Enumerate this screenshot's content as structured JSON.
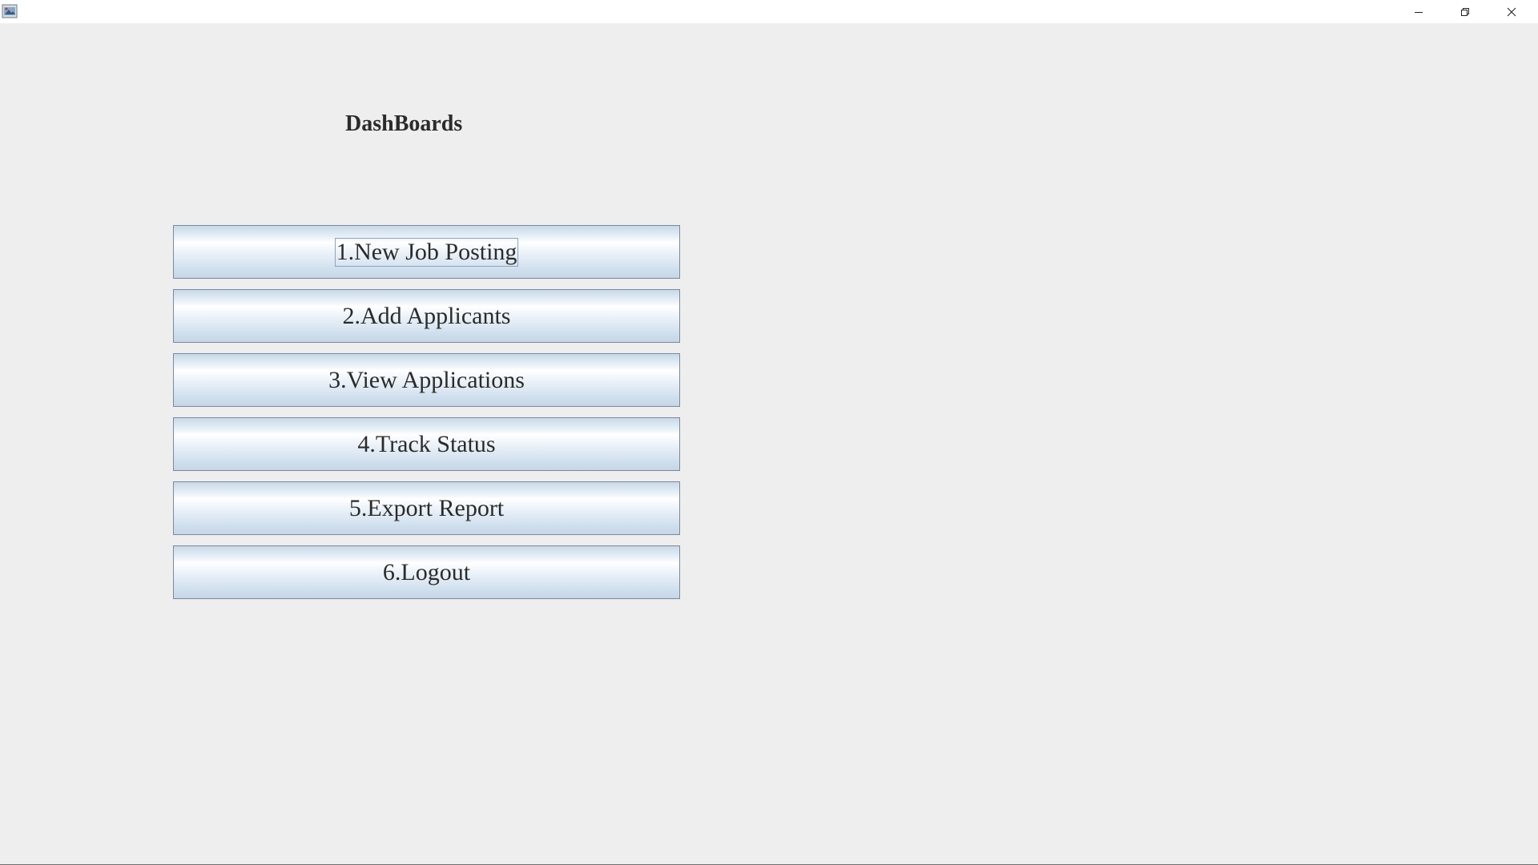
{
  "window": {
    "title": "",
    "controls": {
      "minimize_icon": "minimize-icon",
      "maximize_icon": "restore-icon",
      "close_icon": "close-icon"
    }
  },
  "dashboard": {
    "heading": "DashBoards",
    "buttons": [
      {
        "label": "1.New Job Posting",
        "focused": true
      },
      {
        "label": "2.Add Applicants",
        "focused": false
      },
      {
        "label": "3.View Applications",
        "focused": false
      },
      {
        "label": "4.Track Status",
        "focused": false
      },
      {
        "label": "5.Export Report",
        "focused": false
      },
      {
        "label": "6.Logout",
        "focused": false
      }
    ]
  },
  "colors": {
    "background": "#eeeeee",
    "button_border": "#7a8a9c",
    "button_gradient_light": "#ffffff",
    "button_gradient_dark": "#c6d6e7",
    "text": "#2b2b2b"
  }
}
